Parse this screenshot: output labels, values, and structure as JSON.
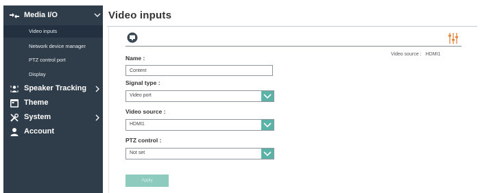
{
  "sidebar": {
    "group": {
      "label": "Media I/O",
      "icon": "media-io-icon"
    },
    "sub_items": [
      {
        "label": "Video inputs",
        "active": true
      },
      {
        "label": "Network device manager",
        "active": false
      },
      {
        "label": "PTZ control port",
        "active": false
      },
      {
        "label": "Display",
        "active": false
      }
    ],
    "items": [
      {
        "label": "Speaker Tracking",
        "icon": "speaker-tracking-icon",
        "has_chevron": true
      },
      {
        "label": "Theme",
        "icon": "theme-icon",
        "has_chevron": false
      },
      {
        "label": "System",
        "icon": "system-tools-icon",
        "has_chevron": true
      },
      {
        "label": "Account",
        "icon": "user-icon",
        "has_chevron": false
      }
    ]
  },
  "main": {
    "title": "Video inputs",
    "video_source_readout": {
      "label": "Video source :",
      "value": "HDMI1"
    },
    "form": {
      "name": {
        "label": "Name :",
        "value": "Content"
      },
      "signal_type": {
        "label": "Signal type :",
        "value": "Video port"
      },
      "video_source": {
        "label": "Video source :",
        "value": "HDMI1"
      },
      "ptz_control": {
        "label": "PTZ control :",
        "value": "Not set"
      },
      "apply_label": "Apply"
    }
  },
  "colors": {
    "sidebar_bg": "#2f3d4a",
    "active_item_bg": "#223040",
    "accent_teal": "#5ab3a6",
    "apply_disabled": "#8ccbbd",
    "settings_icon": "#e8843c"
  }
}
